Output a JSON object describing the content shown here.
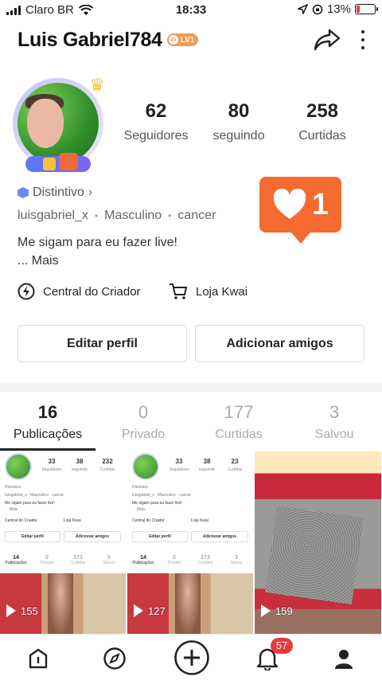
{
  "status_bar": {
    "carrier": "Claro BR",
    "time": "18:33",
    "battery": "13%"
  },
  "profile": {
    "username": "Luis Gabriel784",
    "level_badge": "LV1",
    "level_prefix": "AI",
    "stats": [
      {
        "value": "62",
        "label": "Seguidores"
      },
      {
        "value": "80",
        "label": "seguindo"
      },
      {
        "value": "258",
        "label": "Curtidas"
      }
    ],
    "distintivo": "Distintivo",
    "handle": "luisgabriel_x",
    "gender": "Masculino",
    "sign": "cancer",
    "bio_line1": "Me sigam para eu fazer live!",
    "bio_more": "... Mais"
  },
  "like_notification": {
    "count": "1"
  },
  "creator_links": {
    "center": "Central do Criador",
    "store": "Loja Kwai"
  },
  "actions": {
    "edit": "Editar perfil",
    "add_friends": "Adicionar amigos"
  },
  "tabs": [
    {
      "count": "16",
      "label": "Publicações"
    },
    {
      "count": "0",
      "label": "Privado"
    },
    {
      "count": "177",
      "label": "Curtidas"
    },
    {
      "count": "3",
      "label": "Salvou"
    }
  ],
  "posts": [
    {
      "views": "155",
      "mini": {
        "stats": [
          {
            "v": "33",
            "l": "Seguidores"
          },
          {
            "v": "38",
            "l": "seguindo"
          },
          {
            "v": "232",
            "l": "Curtidas"
          }
        ],
        "distintivo": "Distintivo",
        "meta": "luisgabriel_x · Masculino · cancer",
        "bio": "Me sigam para eu fazer live!",
        "more": "Mais",
        "center": "Central do Criador",
        "store": "Loja Kwai",
        "edit": "Editar perfil",
        "add": "Adicionar amigos",
        "tabs": [
          {
            "n": "14",
            "l": "Publicações"
          },
          {
            "n": "0",
            "l": "Privado"
          },
          {
            "n": "173",
            "l": "Curtidas"
          },
          {
            "n": "3",
            "l": "Salvou"
          }
        ]
      }
    },
    {
      "views": "127",
      "mini": {
        "stats": [
          {
            "v": "33",
            "l": "Seguidores"
          },
          {
            "v": "38",
            "l": "seguindo"
          },
          {
            "v": "23",
            "l": "Curtidas"
          }
        ],
        "distintivo": "Distintivo",
        "meta": "luisgabriel_x · Masculino · cancer",
        "bio": "Me sigam para eu fazer live!",
        "more": "Mais",
        "center": "Central do Criador",
        "store": "Loja Kwai",
        "edit": "Editar perfil",
        "add": "Adicionar amigos",
        "tabs": [
          {
            "n": "14",
            "l": "Publicações"
          },
          {
            "n": "0",
            "l": "Privado"
          },
          {
            "n": "173",
            "l": "Curtidas"
          },
          {
            "n": "3",
            "l": "Salvou"
          }
        ]
      }
    },
    {
      "views": "159"
    }
  ],
  "bottom_nav": {
    "notifications_badge": "57"
  },
  "colors": {
    "accent": "#f56a2f",
    "badge": "#e93a3a",
    "level": "#f39a53"
  }
}
